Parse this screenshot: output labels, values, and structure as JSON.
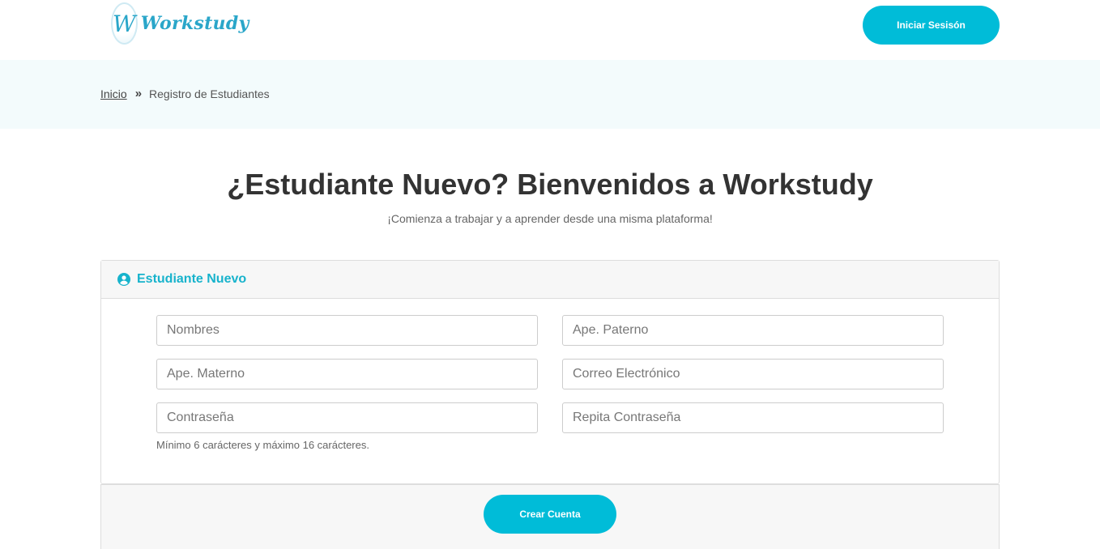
{
  "header": {
    "logo_letter": "W",
    "logo_text": "Workstudy",
    "login_button": "Iniciar Sesisón"
  },
  "breadcrumb": {
    "home": "Inicio",
    "current": "Registro de Estudiantes"
  },
  "hero": {
    "title": "¿Estudiante Nuevo? Bienvenidos a Workstudy",
    "subtitle": "¡Comienza a trabajar y a aprender desde una misma plataforma!"
  },
  "form": {
    "section_title": "Estudiante Nuevo",
    "section_icon": "user-circle-icon",
    "fields": {
      "nombres": {
        "placeholder": "Nombres",
        "value": ""
      },
      "ape_paterno": {
        "placeholder": "Ape. Paterno",
        "value": ""
      },
      "ape_materno": {
        "placeholder": "Ape. Materno",
        "value": ""
      },
      "correo": {
        "placeholder": "Correo Electrónico",
        "value": ""
      },
      "contrasena": {
        "placeholder": "Contraseña",
        "value": ""
      },
      "repita_contrasena": {
        "placeholder": "Repita Contraseña",
        "value": ""
      }
    },
    "password_hint": "Mínimo 6 carácteres y máximo 16 carácteres.",
    "submit_button": "Crear Cuenta"
  },
  "colors": {
    "accent": "#00bcd8",
    "accent_text": "#17b3cc",
    "breadcrumb_band": "#f3fbfc"
  }
}
